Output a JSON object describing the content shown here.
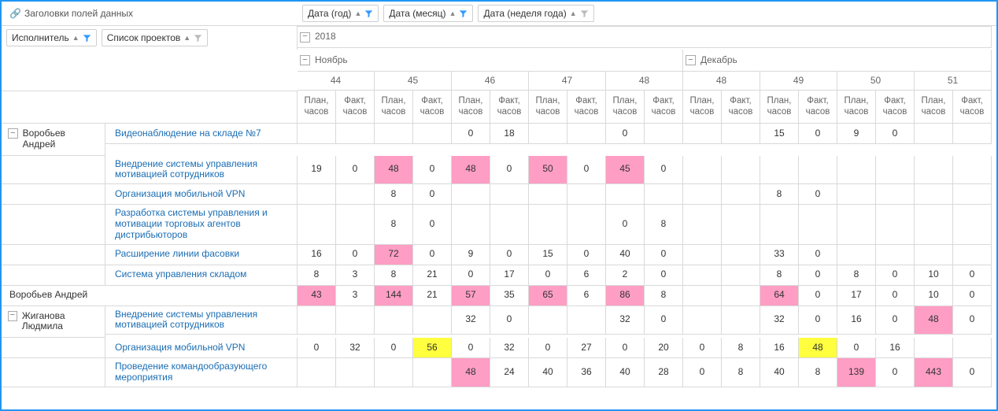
{
  "labels": {
    "rowFieldsHeader": "Заголовки полей данных",
    "colFields": [
      {
        "name": "Дата (год)",
        "filter": true
      },
      {
        "name": "Дата (месяц)",
        "filter": true
      },
      {
        "name": "Дата (неделя года)",
        "filter": false
      }
    ],
    "rowFields": [
      {
        "name": "Исполнитель",
        "filter": true
      },
      {
        "name": "Список проектов",
        "filter": false
      }
    ],
    "year": "2018",
    "months": [
      "Ноябрь",
      "Декабрь"
    ],
    "weeks_nov": [
      "44",
      "45",
      "46",
      "47",
      "48"
    ],
    "weeks_dec": [
      "48",
      "49",
      "50",
      "51"
    ],
    "measures": [
      "План, часов",
      "Факт, часов"
    ]
  },
  "rows": [
    {
      "performer": "Воробьев Андрей",
      "projects": [
        {
          "name": "Видеонаблюдение на складе №7",
          "cells": [
            "",
            "",
            "",
            "",
            "0",
            "18",
            "",
            "",
            "0",
            "",
            "",
            "",
            "15",
            "0",
            "9",
            "0",
            "",
            ""
          ]
        },
        {
          "name": "Внедрение системы управления мотивацией сотрудников",
          "cells": [
            "19",
            "0",
            "48|p",
            "0",
            "48|p",
            "0",
            "50|p",
            "0",
            "45|p",
            "0",
            "",
            "",
            "",
            "",
            "",
            "",
            "",
            ""
          ]
        },
        {
          "name": "Организация мобильной VPN",
          "cells": [
            "",
            "",
            "8",
            "0",
            "",
            "",
            "",
            "",
            "",
            "",
            "",
            "",
            "8",
            "0",
            "",
            "",
            "",
            ""
          ]
        },
        {
          "name": "Разработка системы управления и мотивации торговых агентов дистрибьюторов",
          "cells": [
            "",
            "",
            "8",
            "0",
            "",
            "",
            "",
            "",
            "0",
            "8",
            "",
            "",
            "",
            "",
            "",
            "",
            "",
            ""
          ]
        },
        {
          "name": "Расширение линии фасовки",
          "cells": [
            "16",
            "0",
            "72|p",
            "0",
            "9",
            "0",
            "15",
            "0",
            "40",
            "0",
            "",
            "",
            "33",
            "0",
            "",
            "",
            "",
            ""
          ]
        },
        {
          "name": "Система управления складом",
          "cells": [
            "8",
            "3",
            "8",
            "21",
            "0",
            "17",
            "0",
            "6",
            "2",
            "0",
            "",
            "",
            "8",
            "0",
            "8",
            "0",
            "10",
            "0"
          ]
        }
      ],
      "total": [
        "43|p",
        "3",
        "144|p",
        "21",
        "57|p",
        "35",
        "65|p",
        "6",
        "86|p",
        "8",
        "",
        "",
        "64|p",
        "0",
        "17",
        "0",
        "10",
        "0"
      ]
    },
    {
      "performer": "Жиганова Людмила",
      "projects": [
        {
          "name": "Внедрение системы управления мотивацией сотрудников",
          "cells": [
            "",
            "",
            "",
            "",
            "32",
            "0",
            "",
            "",
            "32",
            "0",
            "",
            "",
            "32",
            "0",
            "16",
            "0",
            "48|p",
            "0"
          ]
        },
        {
          "name": "Организация мобильной VPN",
          "cells": [
            "0",
            "32",
            "0",
            "56|y",
            "0",
            "32",
            "0",
            "27",
            "0",
            "20",
            "0",
            "8",
            "16",
            "48|y",
            "0",
            "16",
            "",
            ""
          ]
        },
        {
          "name": "Проведение командообразующего мероприятия",
          "cells": [
            "",
            "",
            "",
            "",
            "48|p",
            "24",
            "40",
            "36",
            "40",
            "28",
            "0",
            "8",
            "40",
            "8",
            "139|p",
            "0",
            "443|p",
            "0"
          ]
        }
      ]
    }
  ]
}
